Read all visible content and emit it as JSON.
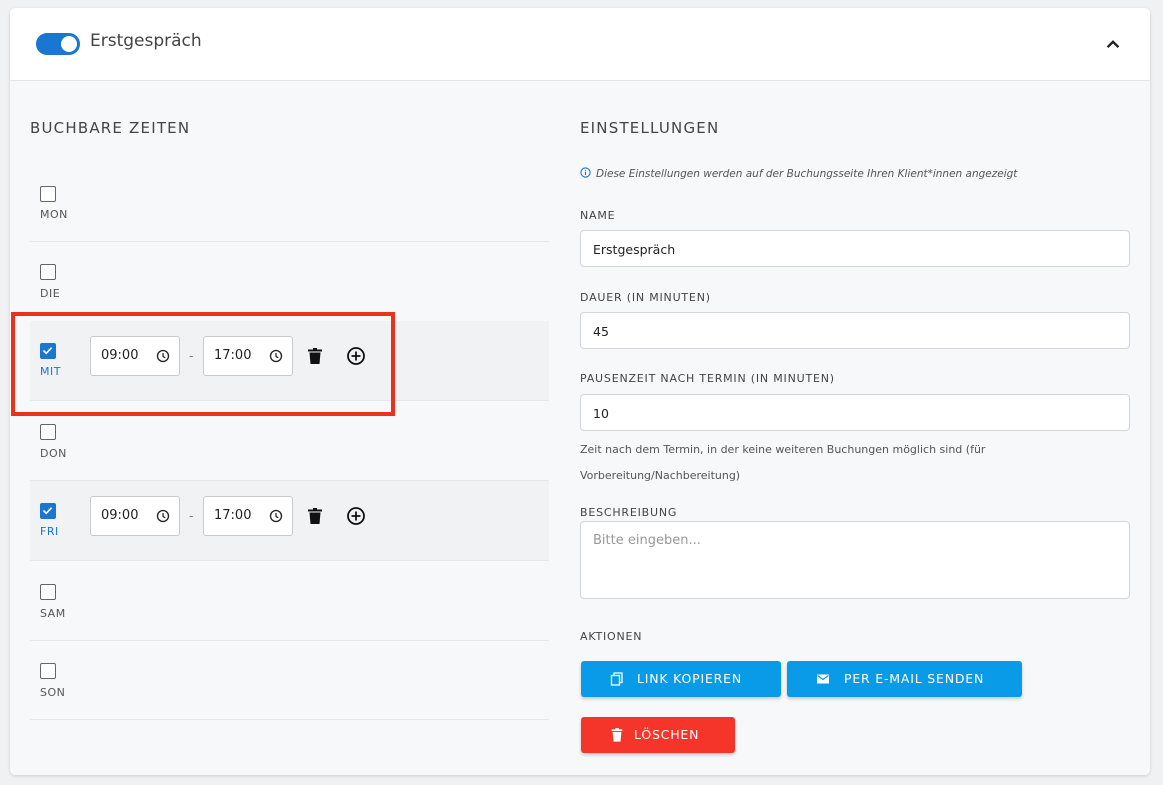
{
  "header": {
    "title": "Erstgespräch",
    "toggle_on": true
  },
  "left": {
    "title": "BUCHBARE ZEITEN",
    "days": [
      {
        "label": "MON",
        "checked": false
      },
      {
        "label": "DIE",
        "checked": false
      },
      {
        "label": "MIT",
        "checked": true,
        "start": "09:00",
        "separator": "-",
        "end": "17:00"
      },
      {
        "label": "DON",
        "checked": false
      },
      {
        "label": "FRI",
        "checked": true,
        "start": "09:00",
        "separator": "-",
        "end": "17:00"
      },
      {
        "label": "SAM",
        "checked": false
      },
      {
        "label": "SON",
        "checked": false
      }
    ]
  },
  "right": {
    "title": "EINSTELLUNGEN",
    "info": "Diese Einstellungen werden auf der Buchungsseite Ihren Klient*innen angezeigt",
    "name": {
      "label": "NAME",
      "value": "Erstgespräch"
    },
    "duration": {
      "label": "DAUER (IN MINUTEN)",
      "value": "45"
    },
    "pause": {
      "label": "PAUSENZEIT NACH TERMIN (IN MINUTEN)",
      "value": "10",
      "helper": "Zeit nach dem Termin, in der keine weiteren Buchungen möglich sind (für Vorbereitung/Nachbereitung)"
    },
    "description": {
      "label": "BESCHREIBUNG",
      "placeholder": "Bitte eingeben..."
    },
    "actions": {
      "label": "AKTIONEN",
      "copy_link": "LINK KOPIEREN",
      "send_email": "PER E-MAIL SENDEN",
      "delete": "LÖSCHEN"
    }
  },
  "colors": {
    "primary": "#1976d2",
    "button_blue": "#0a9be8",
    "button_red": "#f5342a",
    "highlight": "#e8321c"
  }
}
